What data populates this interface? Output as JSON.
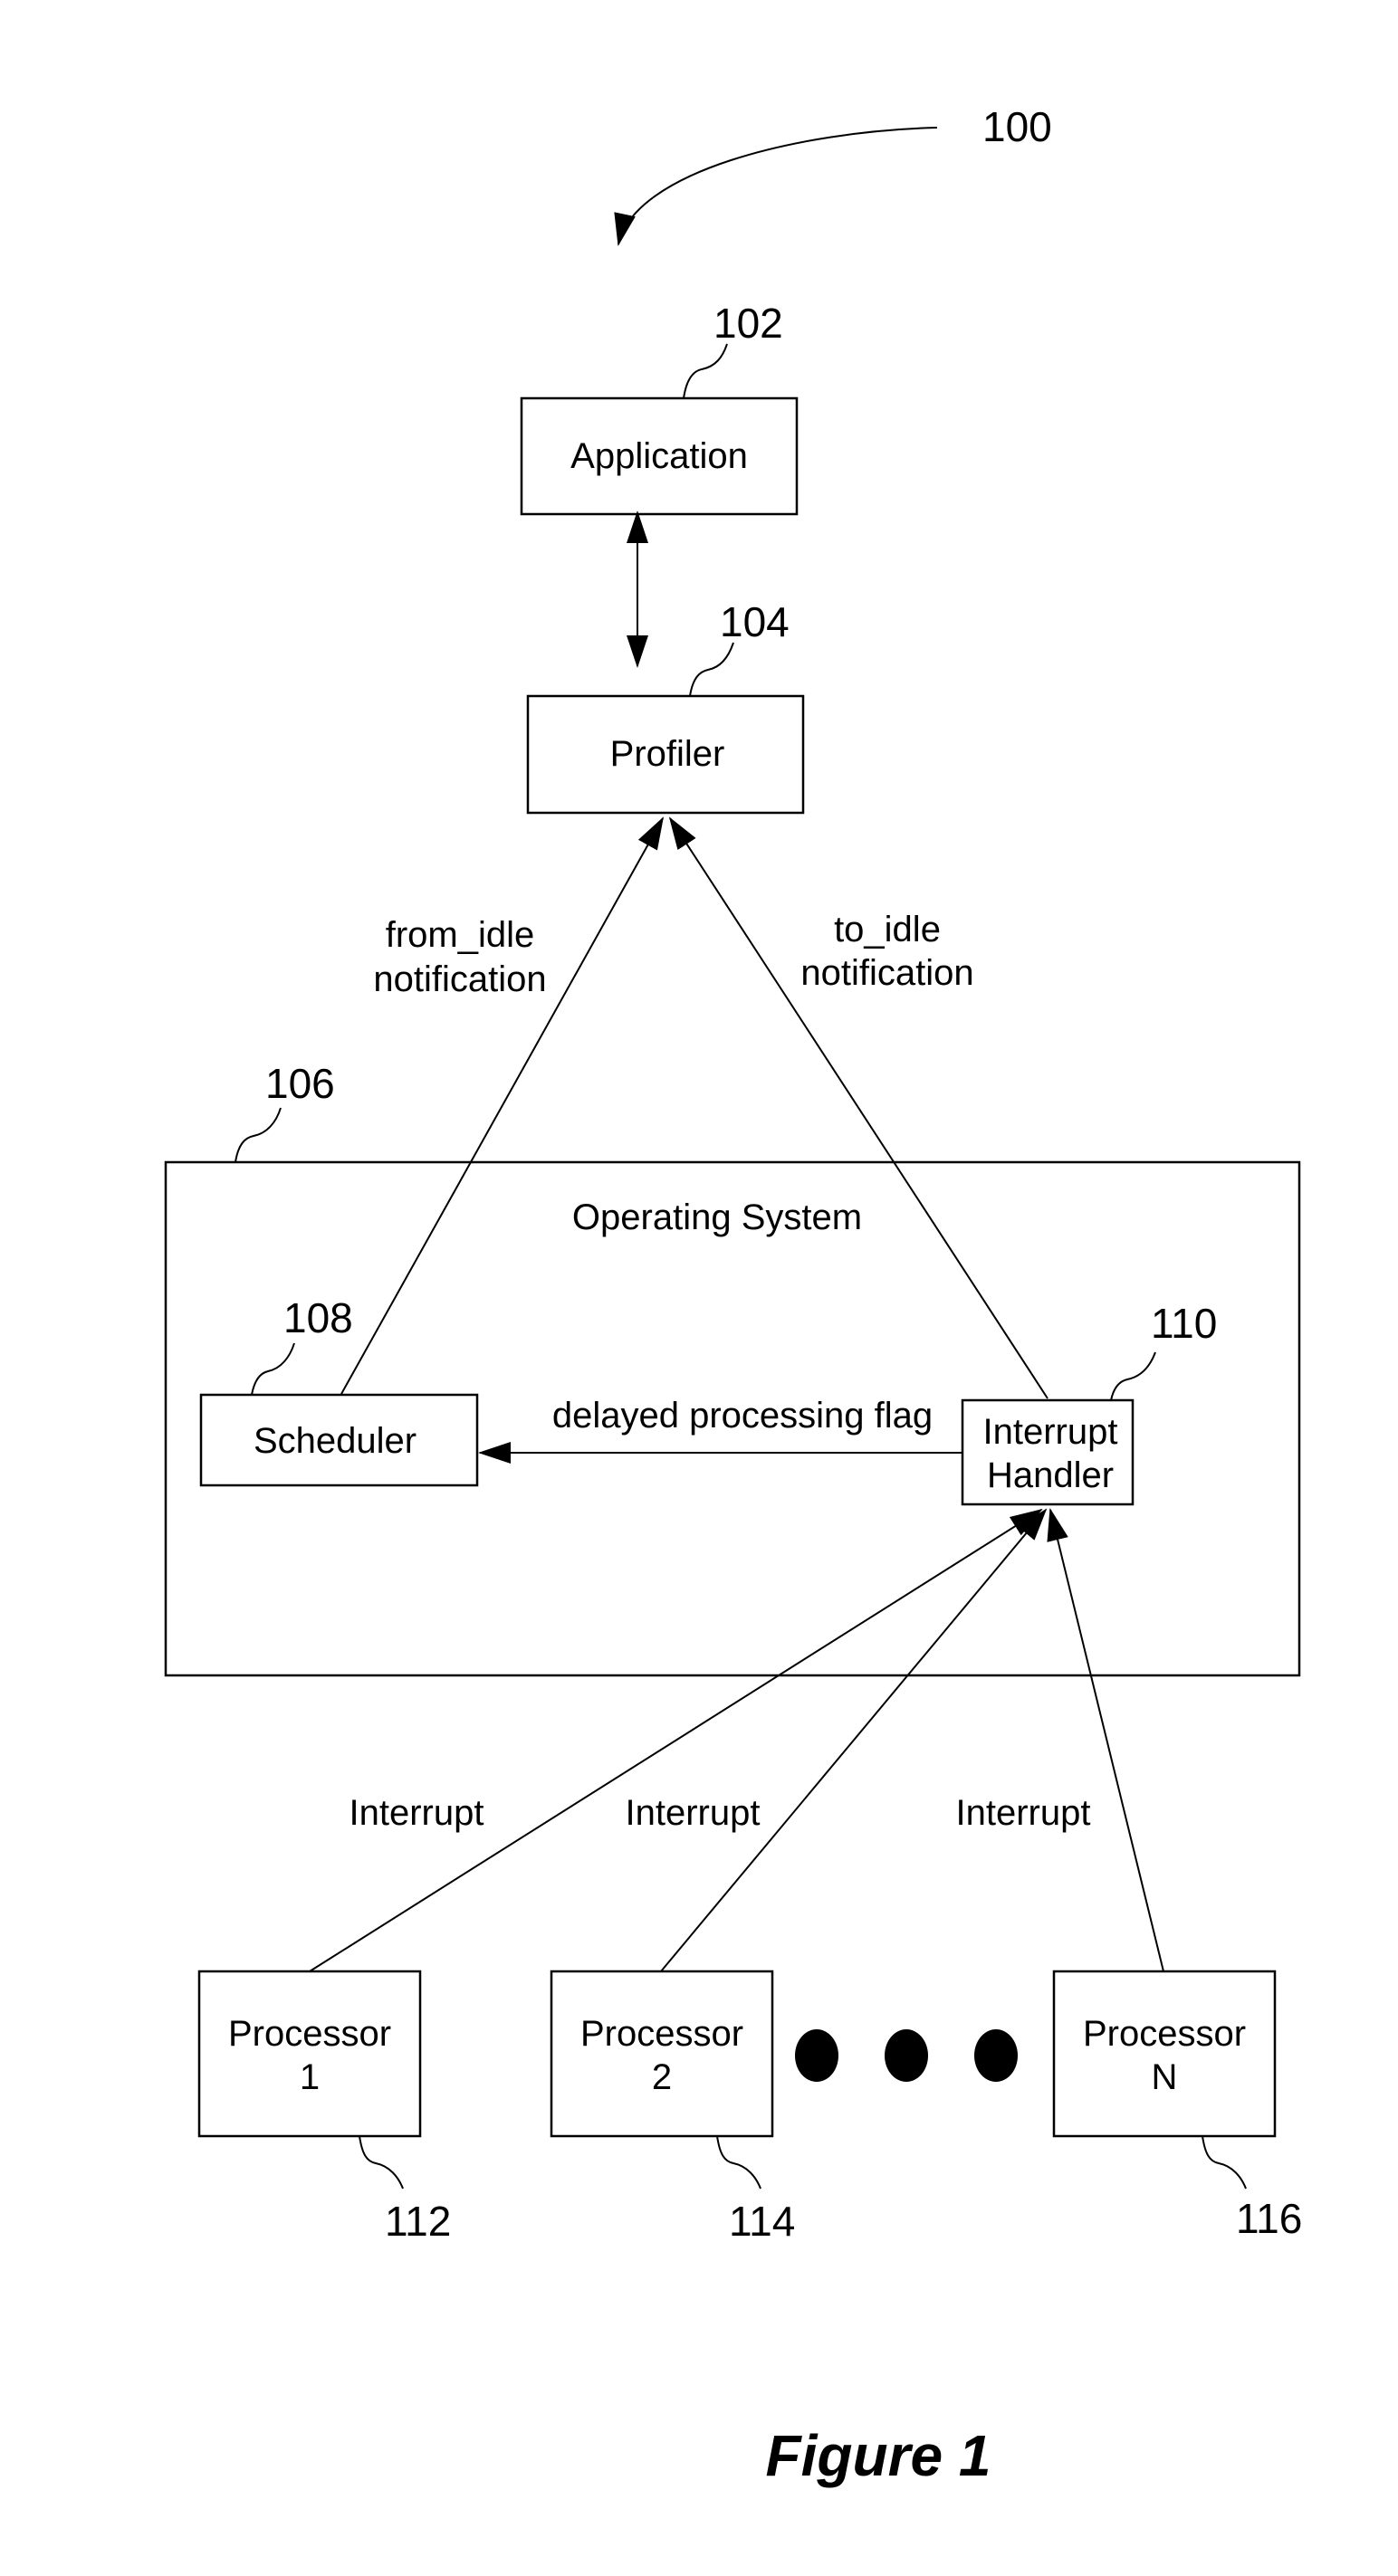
{
  "figure": {
    "caption": "Figure 1",
    "ref": "100"
  },
  "nodes": {
    "application": {
      "label": "Application",
      "ref": "102"
    },
    "profiler": {
      "label": "Profiler",
      "ref": "104"
    },
    "operating_system": {
      "label": "Operating System",
      "ref": "106"
    },
    "scheduler": {
      "label": "Scheduler",
      "ref": "108"
    },
    "interrupt_handler": {
      "label_line1": "Interrupt",
      "label_line2": "Handler",
      "ref": "110"
    },
    "processor_1": {
      "label_line1": "Processor",
      "label_line2": "1",
      "ref": "112"
    },
    "processor_2": {
      "label_line1": "Processor",
      "label_line2": "2",
      "ref": "114"
    },
    "processor_n": {
      "label_line1": "Processor",
      "label_line2": "N",
      "ref": "116"
    }
  },
  "edges": {
    "from_idle": {
      "line1": "from_idle",
      "line2": "notification"
    },
    "to_idle": {
      "line1": "to_idle",
      "line2": "notification"
    },
    "delayed_flag": {
      "label": "delayed processing flag"
    },
    "interrupt_1": {
      "label": "Interrupt"
    },
    "interrupt_2": {
      "label": "Interrupt"
    },
    "interrupt_n": {
      "label": "Interrupt"
    }
  },
  "ellipsis_dots": 3
}
